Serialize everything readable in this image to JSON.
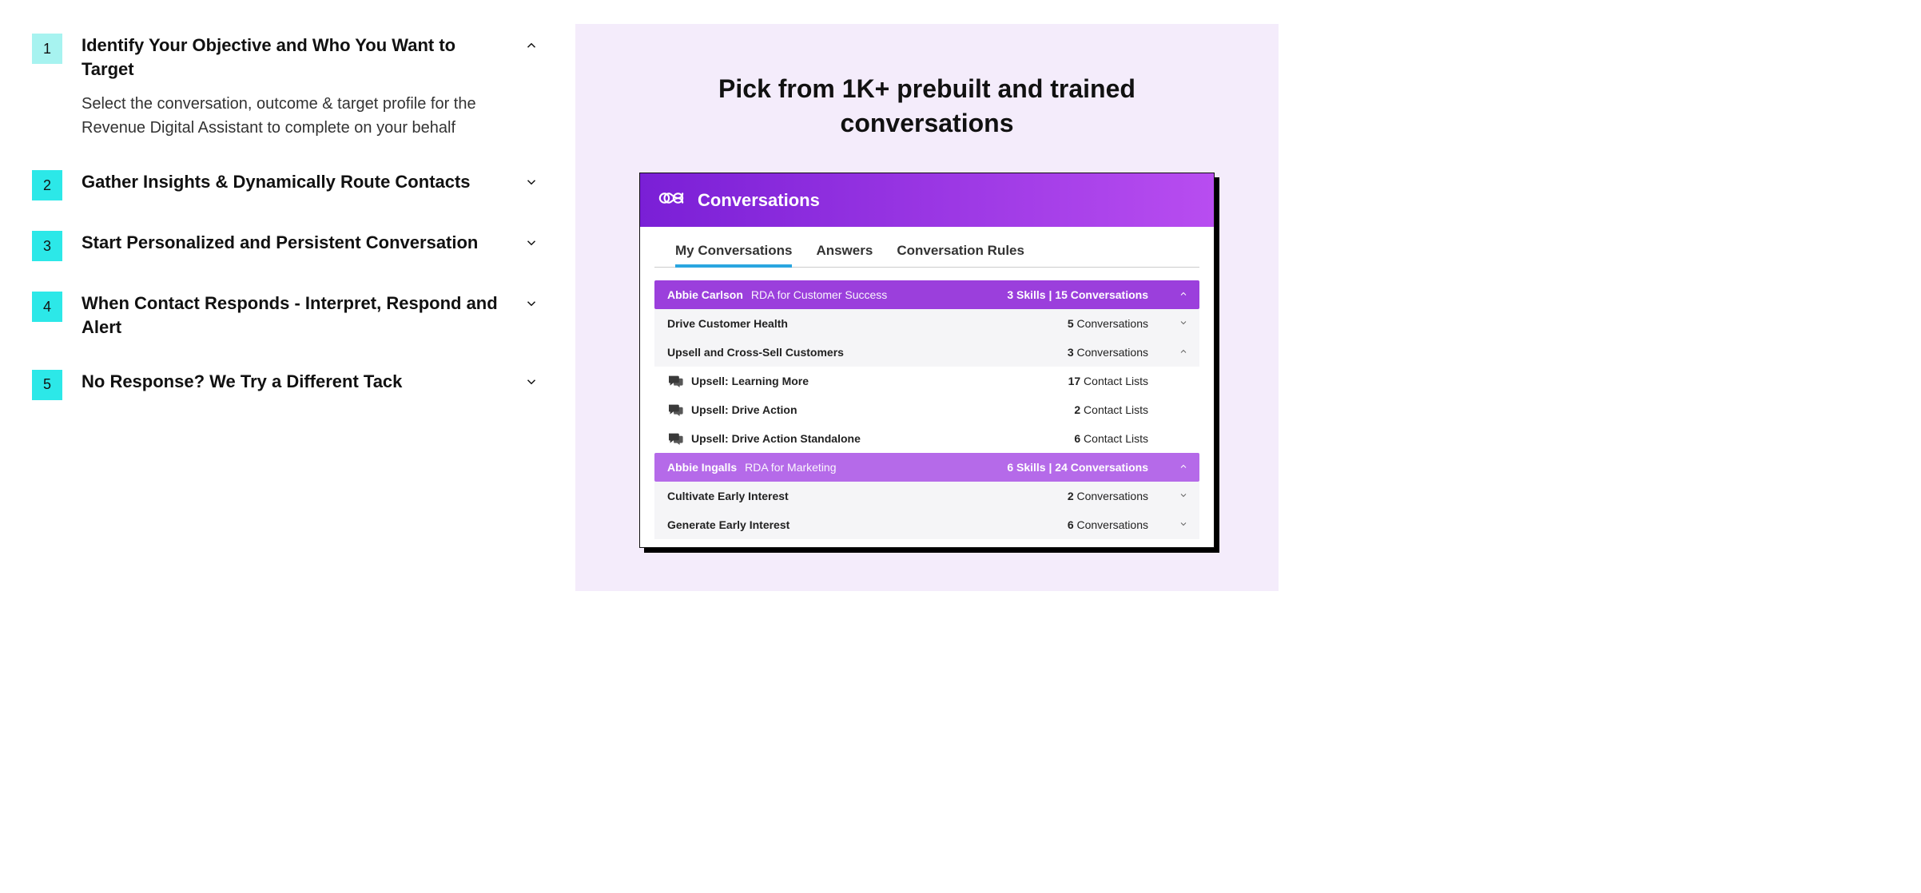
{
  "accordion": [
    {
      "num": "1",
      "title": "Identify Your Objective and Who You Want to Target",
      "desc": "Select the conversation, outcome & target profile for the Revenue Digital Assistant to complete on your behalf",
      "expanded": true
    },
    {
      "num": "2",
      "title": "Gather Insights & Dynamically Route Contacts",
      "expanded": false
    },
    {
      "num": "3",
      "title": "Start Personalized and Persistent Conversation",
      "expanded": false
    },
    {
      "num": "4",
      "title": "When Contact Responds - Interpret, Respond and Alert",
      "expanded": false
    },
    {
      "num": "5",
      "title": "No Response? We Try a Different Tack",
      "expanded": false
    }
  ],
  "right": {
    "heading": "Pick from 1K+ prebuilt and trained conversations",
    "card": {
      "title": "Conversations",
      "tabs": [
        "My Conversations",
        "Answers",
        "Conversation Rules"
      ],
      "active_tab": 0,
      "groups": [
        {
          "name": "Abbie Carlson",
          "role": "RDA for Customer Success",
          "skills_count": "3",
          "conversations_count": "15",
          "expanded": true,
          "style": "dark",
          "skills": [
            {
              "label": "Drive Customer Health",
              "count": "5",
              "unit": "Conversations",
              "expanded": false
            },
            {
              "label": "Upsell and Cross-Sell Customers",
              "count": "3",
              "unit": "Conversations",
              "expanded": true,
              "conversations": [
                {
                  "label": "Upsell: Learning More",
                  "count": "17",
                  "unit": "Contact Lists"
                },
                {
                  "label": "Upsell: Drive Action",
                  "count": "2",
                  "unit": "Contact Lists"
                },
                {
                  "label": "Upsell: Drive Action Standalone",
                  "count": "6",
                  "unit": "Contact Lists"
                }
              ]
            }
          ]
        },
        {
          "name": "Abbie Ingalls",
          "role": "RDA for Marketing",
          "skills_count": "6",
          "conversations_count": "24",
          "expanded": true,
          "style": "light",
          "skills": [
            {
              "label": "Cultivate Early Interest",
              "count": "2",
              "unit": "Conversations",
              "expanded": false
            },
            {
              "label": "Generate Early Interest",
              "count": "6",
              "unit": "Conversations",
              "expanded": false
            }
          ]
        }
      ]
    }
  },
  "labels": {
    "skills_word": "Skills",
    "conversations_word": "Conversations",
    "sep": "  |  "
  }
}
